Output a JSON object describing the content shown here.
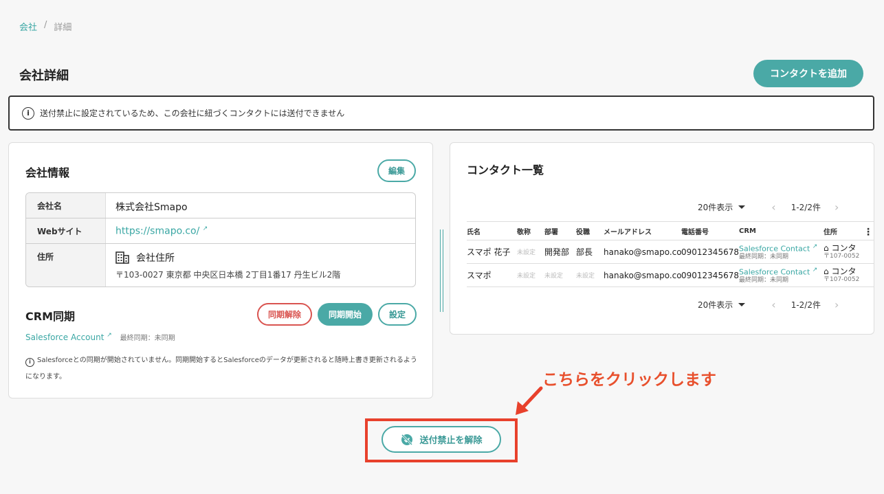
{
  "breadcrumb": {
    "root": "会社",
    "sep": "/",
    "current": "詳細"
  },
  "header": {
    "title": "会社詳細",
    "add_contact_label": "コンタクトを追加"
  },
  "alert": {
    "icon": "info-icon",
    "text": "送付禁止に設定されているため、この会社に紐づくコンタクトには送付できません"
  },
  "company": {
    "title": "会社情報",
    "edit_label": "編集",
    "rows": [
      {
        "label": "会社名",
        "value": "株式会社Smapo"
      },
      {
        "label": "Webサイト",
        "value": "https://smapo.co/"
      },
      {
        "label": "住所",
        "value": "会社住所",
        "detail": "〒103-0027 東京都 中央区日本橋 2丁目1番17 丹生ビル2階"
      }
    ],
    "crm": {
      "title": "CRM同期",
      "unsync_label": "同期解除",
      "sync_start_label": "同期開始",
      "settings_label": "設定",
      "account_link": "Salesforce Account",
      "last_sync": "最終同期：未同期",
      "note": "Salesforceとの同期が開始されていません。同期開始するとSalesforceのデータが更新されると随時上書き更新されるようになります。"
    }
  },
  "contacts": {
    "title": "コンタクト一覧",
    "page_size": "20件表示",
    "range": "1-2/2件",
    "headers": [
      "氏名",
      "敬称",
      "部署",
      "役職",
      "メールアドレス",
      "電話番号",
      "CRM",
      "住所"
    ],
    "rows": [
      {
        "name": "スマポ 花子",
        "honorific": "未設定",
        "dept": "開発部",
        "position": "部長",
        "email": "hanako@smapo.co",
        "phone": "09012345678",
        "crm": "Salesforce Contact",
        "crm_sync": "最終同期：未同期",
        "address": "コンタ",
        "postal": "〒107-0052"
      },
      {
        "name": "スマポ",
        "honorific": "未設定",
        "dept": "未設定",
        "position": "未設定",
        "email": "hanako@smapo.co",
        "phone": "09012345678",
        "crm": "Salesforce Contact",
        "crm_sync": "最終同期：未同期",
        "address": "コンタ",
        "postal": "〒107-0052"
      }
    ]
  },
  "annotation": {
    "callout": "こちらをクリックします"
  },
  "unblock": {
    "label": "送付禁止を解除",
    "icon": "block-off-icon"
  },
  "colors": {
    "accent": "#4aa9a6",
    "danger": "#d9534f",
    "annotation": "#e8502d"
  }
}
